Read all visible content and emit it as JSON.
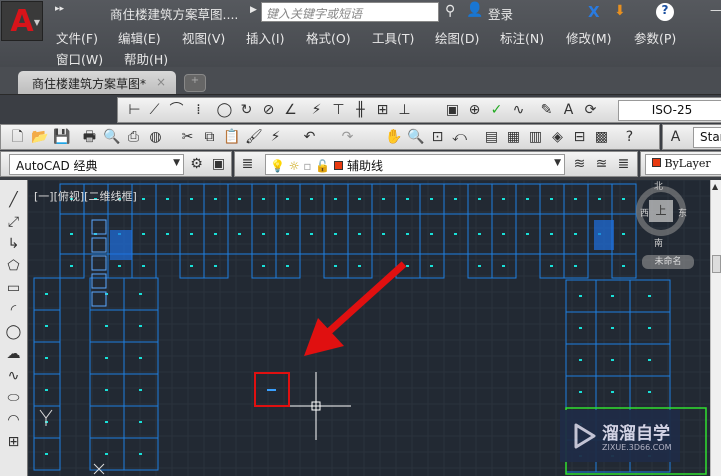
{
  "app": {
    "title": "商住楼建筑方案草图....",
    "search_placeholder": "键入关键字或短语",
    "login": "登录"
  },
  "menu": [
    "文件(F)",
    "编辑(E)",
    "视图(V)",
    "插入(I)",
    "格式(O)",
    "工具(T)",
    "绘图(D)",
    "标注(N)",
    "修改(M)",
    "参数(P)",
    "窗口(W)",
    "帮助(H)"
  ],
  "tabs": [
    {
      "label": "商住楼建筑方案草图*",
      "active": true
    }
  ],
  "toolbars": {
    "dimstyle": "ISO-25",
    "textstyle": "Star",
    "workspace": "AutoCAD 经典",
    "layer": "辅助线",
    "color": "ByLayer",
    "layer_color": "#e83a10"
  },
  "viewport": {
    "label": "[一][俯视][二维线框]",
    "background": "#222933",
    "line_color": "#1e7fe0",
    "marker_color": "#19e0d8"
  },
  "viewcube": {
    "north": "北",
    "south": "南",
    "east": "东",
    "west": "西",
    "top": "上",
    "wcs": "未命名"
  },
  "annotation": {
    "arrow_color": "#e01010",
    "highlight_color": "#e01010"
  },
  "watermark": {
    "name": "溜溜自学",
    "url": "ZIXUE.3D66.COM"
  }
}
